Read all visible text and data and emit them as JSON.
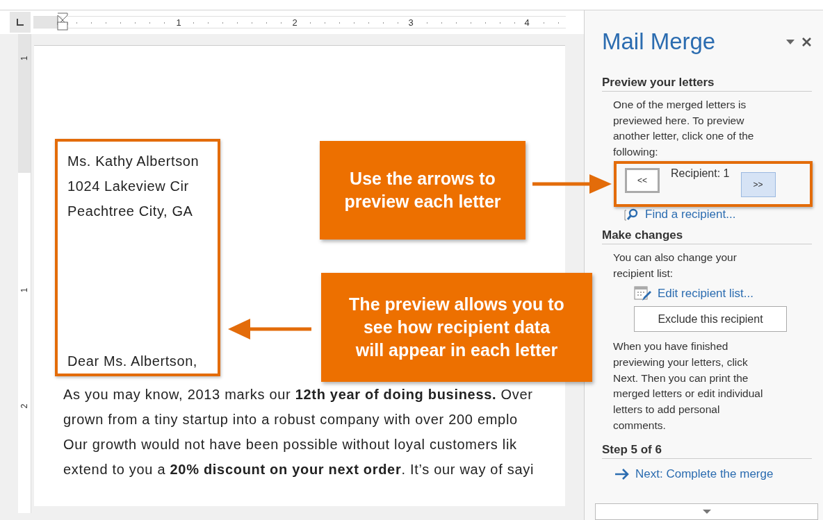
{
  "ruler": {
    "numbers": [
      "1",
      "2",
      "3",
      "4"
    ]
  },
  "vertical_ruler": {
    "numbers": [
      "1",
      "1",
      "2"
    ]
  },
  "letter": {
    "address_lines": [
      "Ms. Kathy Albertson",
      "1024 Lakeview Cir",
      "Peachtree City, GA"
    ],
    "salutation": "Dear Ms. Albertson,",
    "body_lines": [
      "As you may know, 2013 marks our **12th year of doing business.** Over",
      "grown from a tiny startup into a robust company with over 200 emplo",
      "Our growth would not have been possible without loyal customers lik",
      "extend to you a **20% discount on your next order**. It’s our way of sayi"
    ]
  },
  "callouts": [
    {
      "text": "Use the arrows to\npreview each letter"
    },
    {
      "text": "The preview allows you to\nsee how recipient data\nwill appear in each letter"
    }
  ],
  "panel": {
    "title": "Mail Merge",
    "preview": {
      "heading": "Preview your letters",
      "description": "One of the merged letters is previewed here. To preview another letter, click one of the following:",
      "prev_button": {
        "label": "<<",
        "hovered": false
      },
      "recipient_label": "Recipient: 1",
      "next_button": {
        "label": ">>",
        "hovered": true
      },
      "find_link": "Find a recipient..."
    },
    "changes": {
      "heading": "Make changes",
      "description": "You can also change your recipient list:",
      "edit_link": "Edit recipient list...",
      "exclude_button": "Exclude this recipient",
      "finish_text": "When you have finished previewing your letters, click Next. Then you can print the merged letters or edit individual letters to add personal comments."
    },
    "step": {
      "heading": "Step 5 of 6",
      "next_link": "Next: Complete the merge"
    }
  }
}
